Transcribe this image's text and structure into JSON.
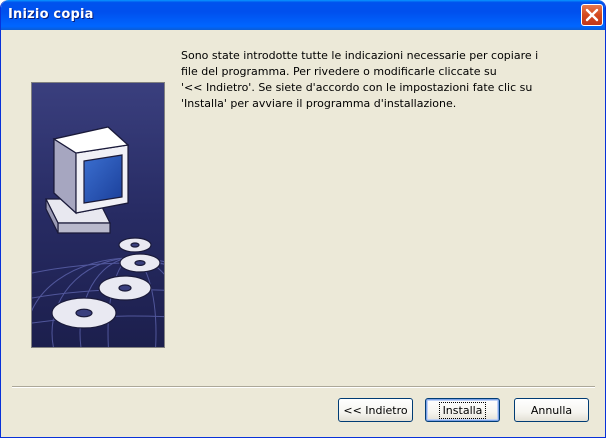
{
  "window": {
    "title": "Inizio copia"
  },
  "message": {
    "lines": [
      "Sono state introdotte tutte le indicazioni necessarie per copiare i",
      "file del programma. Per rivedere o modificarle cliccate su",
      "'<< Indietro'. Se siete d'accordo con le impostazioni fate clic su",
      "'Installa' per avviare il programma d'installazione."
    ]
  },
  "buttons": {
    "back_label": "<< Indietro",
    "install_label": "Installa",
    "cancel_label": "Annulla"
  },
  "colors": {
    "titlebar_blue": "#0054e3",
    "close_red": "#d44a1e",
    "dialog_bg": "#ece9d8",
    "art_bg": "#2a2f6b"
  },
  "icons": {
    "close": "close-icon",
    "illustration": "computer-cd-illustration"
  }
}
